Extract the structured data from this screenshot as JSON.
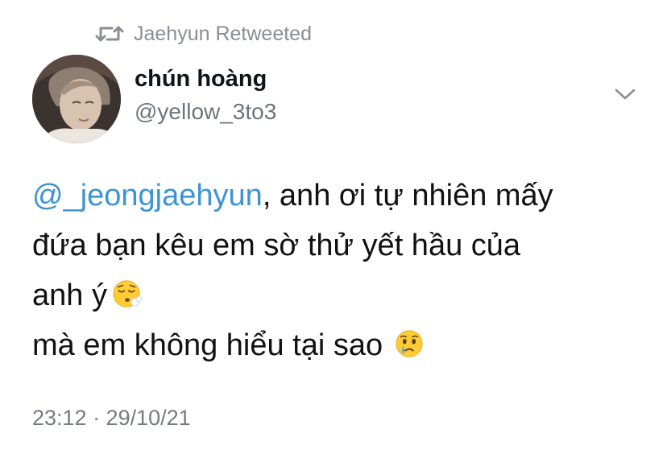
{
  "retweet": {
    "icon": "retweet-icon",
    "text": "Jaehyun Retweeted"
  },
  "author": {
    "display_name": "chún hoàng",
    "handle": "@yellow_3to3",
    "avatar": "avatar-photo"
  },
  "menu": {
    "icon": "chevron-down-icon"
  },
  "tweet": {
    "mention": "@_jeongjaehyun",
    "line1_rest": ", anh ơi tự nhiên mấy",
    "line2": "đứa bạn kêu em sờ thử yết hầu của",
    "line3": "anh ý",
    "line3_emoji": "face-exhaling-emoji",
    "line4": "mà em không hiểu tại sao",
    "line4_emoji": "face-holding-back-tears-emoji"
  },
  "meta": {
    "timestamp": "23:12 · 29/10/21"
  },
  "colors": {
    "mention": "#3d94d4",
    "secondary_text": "#6f7479",
    "primary_text": "#0f1419"
  }
}
